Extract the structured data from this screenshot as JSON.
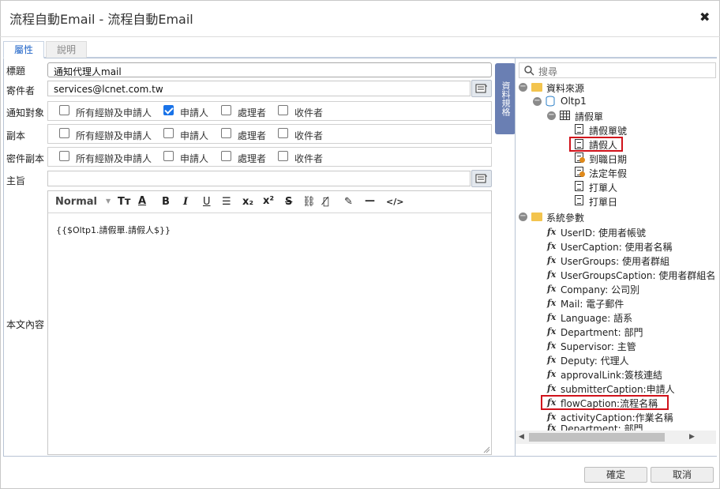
{
  "dialog": {
    "title": "流程自動Email - 流程自動Email",
    "close_glyph": "✖"
  },
  "tabs": [
    {
      "label": "屬性",
      "active": true
    },
    {
      "label": "說明",
      "active": false
    }
  ],
  "form": {
    "subject_label": "標題",
    "subject_value": "通知代理人mail",
    "sender_label": "寄件者",
    "sender_value": "services@lcnet.com.tw",
    "notify_label": "通知對象",
    "cc_label": "副本",
    "bcc_label": "密件副本",
    "topic_label": "主旨",
    "topic_value": "",
    "body_label": "本文內容",
    "options": [
      "所有經辦及申請人",
      "申請人",
      "處理者",
      "收件者"
    ],
    "notify_checked": [
      false,
      true,
      false,
      false
    ],
    "cc_checked": [
      false,
      false,
      false,
      false
    ],
    "bcc_checked": [
      false,
      false,
      false,
      false
    ],
    "picker_icon": "picker-icon"
  },
  "editor": {
    "format": "Normal",
    "content": "{{$Oltp1.請假單.請假人$}}",
    "tools": [
      "Tт",
      "A",
      "B",
      "I",
      "U",
      "☰",
      "x₂",
      "x²",
      "S",
      "⛓",
      "⛓̸",
      "✎",
      "—",
      "</>"
    ]
  },
  "side_tab": {
    "label": "資料規格"
  },
  "tree": {
    "search_placeholder": "搜尋",
    "datasource": "資料來源",
    "oltp": "Oltp1",
    "table": "請假單",
    "fields": [
      "請假單號",
      "請假人",
      "到職日期",
      "法定年假",
      "打單人",
      "打單日"
    ],
    "highlighted_field": "請假人",
    "sysparams": "系統參數",
    "params": [
      "UserID: 使用者帳號",
      "UserCaption: 使用者名稱",
      "UserGroups: 使用者群組",
      "UserGroupsCaption: 使用者群組名",
      "Company: 公司別",
      "Mail: 電子郵件",
      "Language: 語系",
      "Department: 部門",
      "Supervisor: 主管",
      "Deputy: 代理人",
      "approvalLink:簽核連結",
      "submitterCaption:申請人",
      "flowCaption:流程名稱",
      "activityCaption:作業名稱",
      "Department: 部門"
    ],
    "highlighted_param": "flowCaption:流程名稱",
    "fx_glyph": "fx"
  },
  "buttons": {
    "ok": "確定",
    "cancel": "取消"
  }
}
